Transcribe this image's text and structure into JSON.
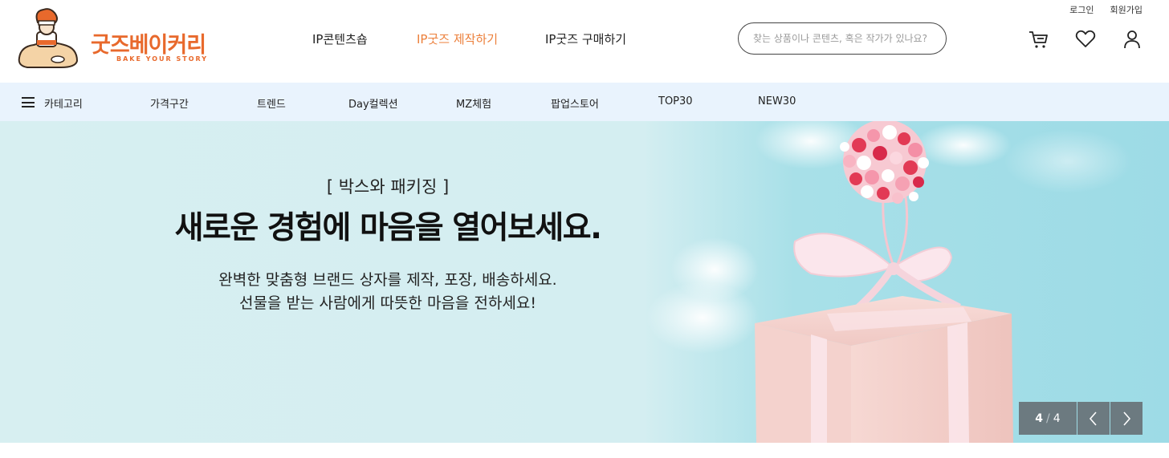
{
  "header": {
    "util_links": {
      "login": "로그인",
      "signup": "회원가입"
    },
    "logo": {
      "title": "굿즈베이커리",
      "subtitle": "BAKE YOUR STORY"
    },
    "nav": [
      "IP콘텐츠숍",
      "IP굿즈 제작하기",
      "IP굿즈 구매하기"
    ],
    "active_nav_color": "#ec7f3a",
    "search": {
      "placeholder": "찾는 상품이나 콘텐츠, 혹은 작가가 있나요?"
    },
    "icons": [
      "cart-icon",
      "heart-icon",
      "user-icon"
    ]
  },
  "category_bar": {
    "menu_label": "카테고리",
    "items": [
      "가격구간",
      "트렌드",
      "Day컬렉션",
      "MZ체험",
      "팝업스토어",
      "TOP30",
      "NEW30"
    ],
    "background": "#e9f3fd"
  },
  "hero": {
    "tag": "[ 박스와 패키징 ]",
    "title": "새로운 경험에 마음을 열어보세요.",
    "desc_line1": "완벽한 맞춤형 브랜드 상자를 제작, 포장, 배송하세요.",
    "desc_line2": "선물을 받는 사람에게 따뜻한 마음을 전하세요!",
    "pager": {
      "current": "4",
      "separator": "/",
      "total": "4"
    },
    "background": "#d7eff1"
  },
  "brand_color": "#e8692c"
}
